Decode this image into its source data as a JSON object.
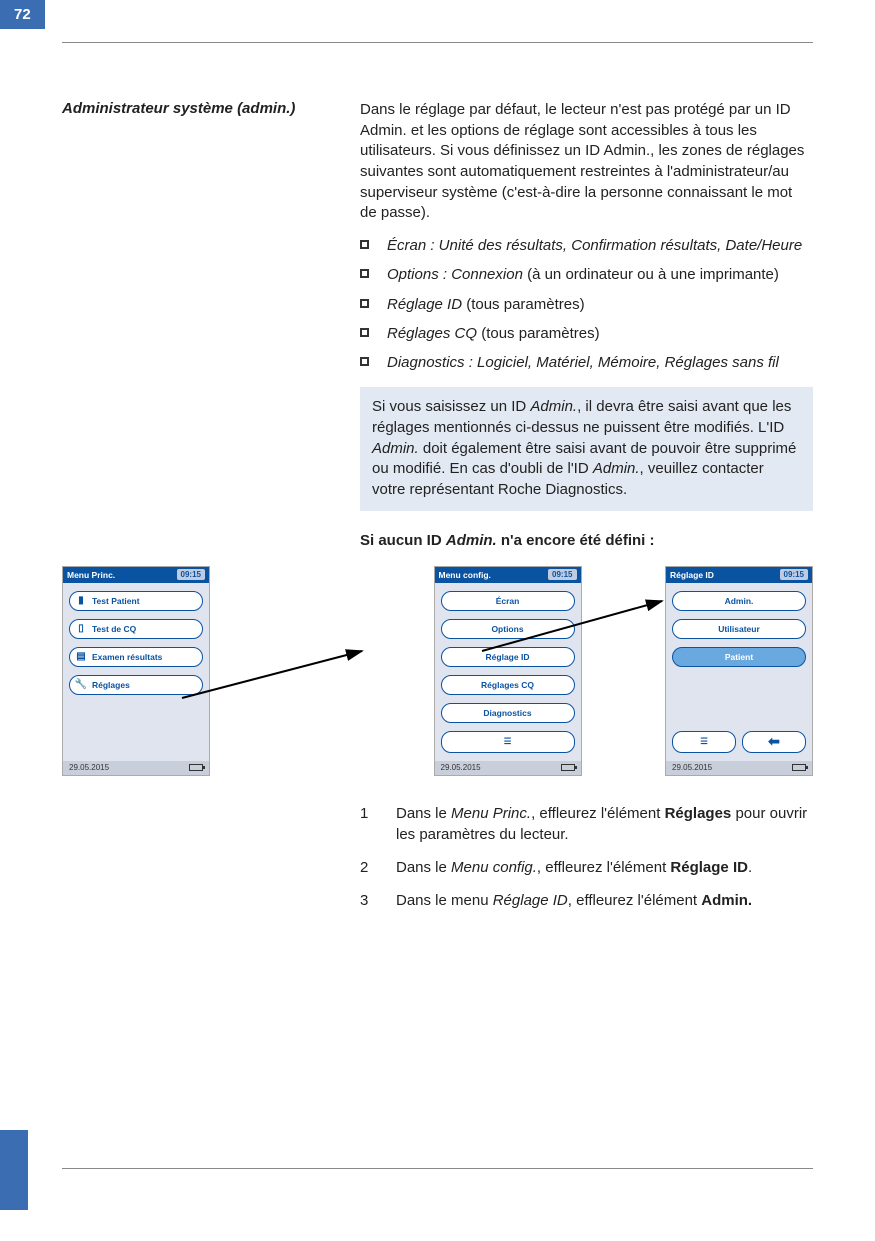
{
  "page_number": "72",
  "section_title": "Administrateur système (admin.)",
  "intro_paragraph": "Dans le réglage par défaut, le lecteur n'est pas protégé par un ID Admin. et les options de réglage sont accessibles à tous les utilisateurs. Si vous définissez un ID Admin., les zones de réglages suivantes sont automatiquement restreintes à l'administrateur/au superviseur système (c'est-à-dire la personne connaissant le mot de passe).",
  "bullets": [
    {
      "italic": "Écran : Unité des résultats, Confirmation résultats, Date/Heure",
      "plain": ""
    },
    {
      "italic": "Options : Connexion",
      "plain": " (à un ordinateur ou à une imprimante)"
    },
    {
      "italic": "Réglage ID",
      "plain": " (tous paramètres)"
    },
    {
      "italic": "Réglages CQ",
      "plain": " (tous paramètres)"
    },
    {
      "italic": "Diagnostics : Logiciel, Matériel, Mémoire, Réglages sans fil",
      "plain": ""
    }
  ],
  "note_box": {
    "p1a": "Si vous saisissez un ID ",
    "p1b": "Admin.",
    "p1c": ", il devra être saisi avant que les réglages mentionnés ci-dessus ne puissent être modifiés. L'ID ",
    "p1d": "Admin.",
    "p1e": " doit également être saisi avant de pouvoir être supprimé ou modifié. En cas d'oubli de l'ID ",
    "p1f": "Admin.",
    "p1g": ", veuillez contacter votre représentant Roche Diagnostics."
  },
  "sub_heading_a": "Si aucun ID ",
  "sub_heading_b": "Admin.",
  "sub_heading_c": " n'a encore été défini :",
  "screens": {
    "time": "09:15",
    "date": "29.05.2015",
    "s1": {
      "title": "Menu Princ.",
      "items": [
        "Test Patient",
        "Test de CQ",
        "Examen résultats",
        "Réglages"
      ]
    },
    "s2": {
      "title": "Menu config.",
      "items": [
        "Écran",
        "Options",
        "Réglage ID",
        "Réglages CQ",
        "Diagnostics"
      ]
    },
    "s3": {
      "title": "Réglage ID",
      "items": [
        "Admin.",
        "Utilisateur",
        "Patient"
      ]
    }
  },
  "steps": [
    {
      "n": "1",
      "a": "Dans le ",
      "i": "Menu Princ.",
      "b": ", effleurez l'élément ",
      "bold": "Réglages",
      "c": " pour ouvrir les paramètres du lecteur."
    },
    {
      "n": "2",
      "a": "Dans le ",
      "i": "Menu config.",
      "b": ", effleurez l'élément ",
      "bold": "Réglage ID",
      "c": "."
    },
    {
      "n": "3",
      "a": "Dans le menu ",
      "i": "Réglage ID",
      "b": ", effleurez l'élément ",
      "bold": "Admin.",
      "c": ""
    }
  ]
}
